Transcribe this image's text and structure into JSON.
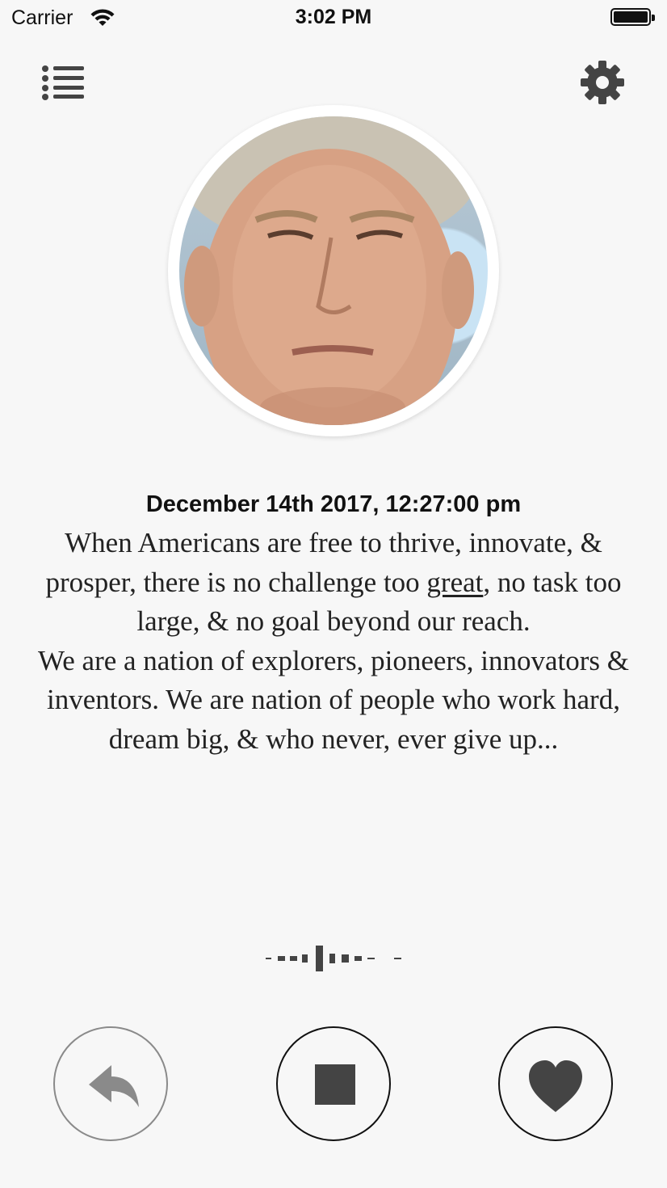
{
  "status_bar": {
    "carrier": "Carrier",
    "time": "3:02 PM",
    "icons": [
      "wifi-icon",
      "battery-icon"
    ]
  },
  "nav": {
    "left_icon": "list-menu-icon",
    "right_icon": "gear-icon"
  },
  "post": {
    "timestamp": "December 14th 2017, 12:27:00 pm",
    "quote_part1": "When Americans are free to thrive, innovate, & prosper, there is no challenge too ",
    "quote_underlined": "great",
    "quote_part2": ", no task too large, & no goal beyond our reach.",
    "quote_part3": "We are a nation of explorers, pioneers, innovators & inventors. We are nation of people who work hard, dream big, & who never, ever give up..."
  },
  "controls": {
    "reply_icon": "reply-icon",
    "stop_icon": "stop-icon",
    "like_icon": "heart-icon"
  },
  "colors": {
    "background": "#f7f7f7",
    "icon_dark": "#444444",
    "reply_gray": "#8a8a8a"
  }
}
